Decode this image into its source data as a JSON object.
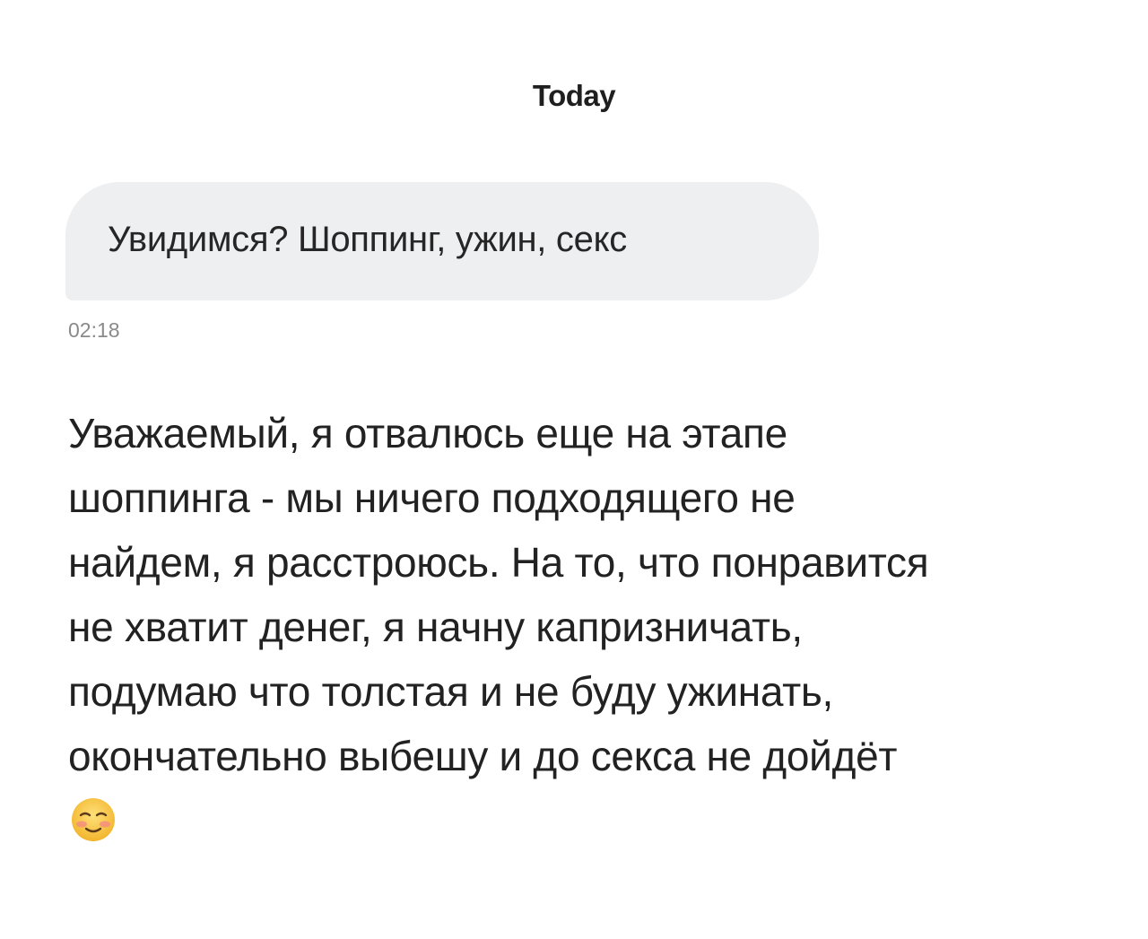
{
  "date_header": "Today",
  "incoming_message": {
    "text": "Увидимся? Шоппинг, ужин, секс",
    "time": "02:18"
  },
  "reply_message": {
    "lines": [
      "Уважаемый, я отвалюсь еще на этапе",
      "шоппинга - мы ничего подходящего не",
      "найдем, я расстроюсь. На то, что понравится",
      "не хватит денег, я начну капризничать,",
      "подумаю что толстая и не буду ужинать,",
      "окончательно выбешу и до секса не дойдёт"
    ],
    "emoji": "smiling-face-with-blush-icon"
  },
  "colors": {
    "bubble_background": "#eeeff1",
    "timestamp": "#8a8a8a",
    "text": "#222222",
    "emoji_face": "#f7c541"
  }
}
